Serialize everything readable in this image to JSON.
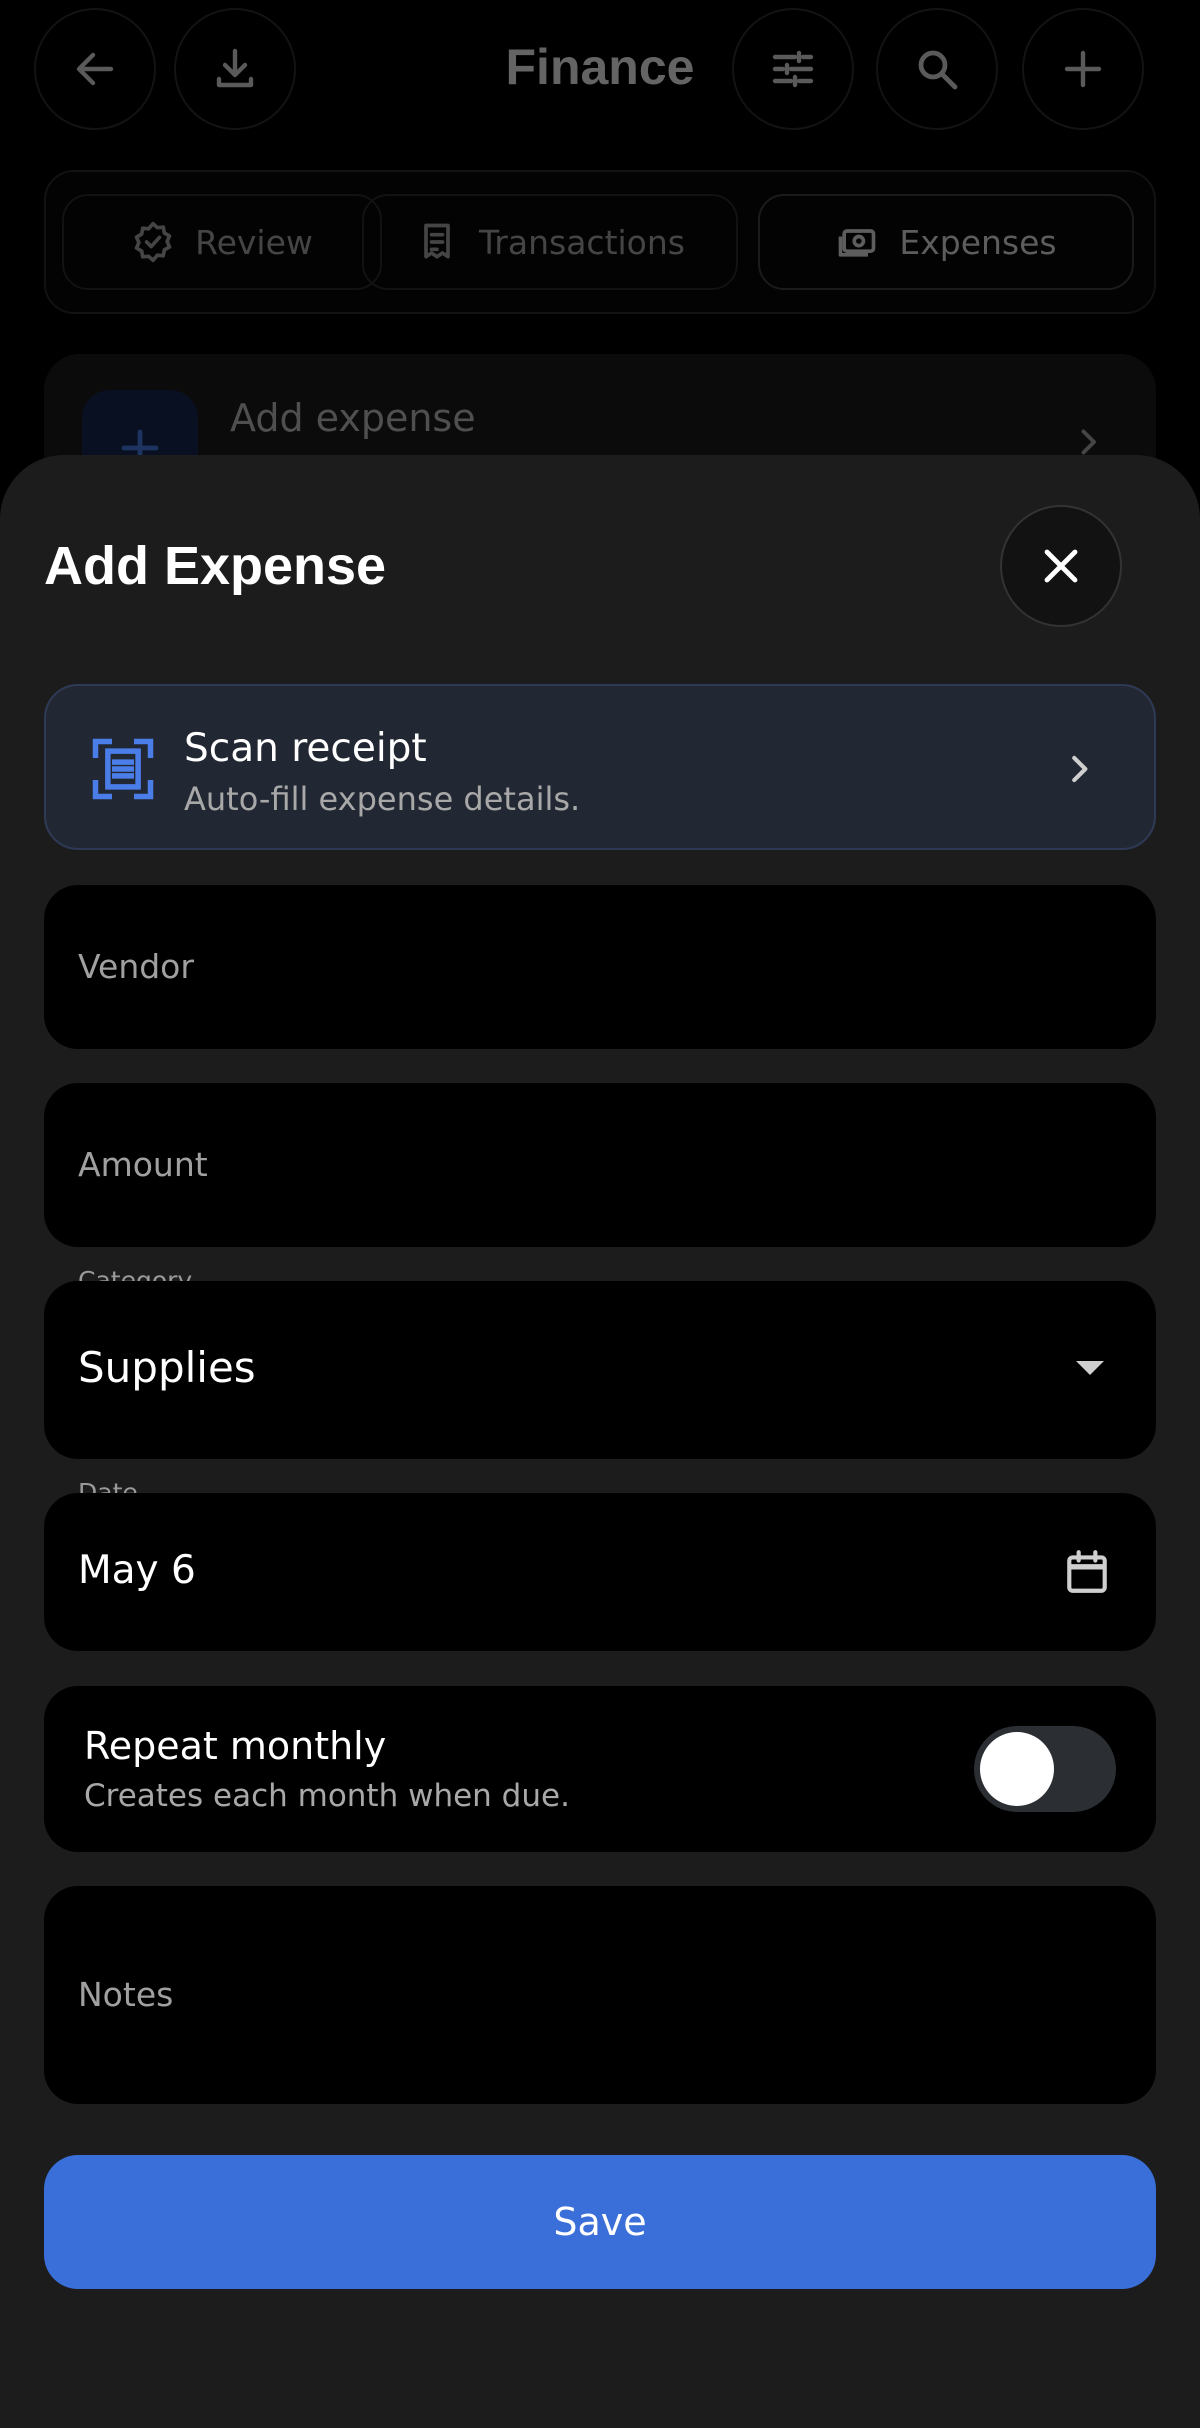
{
  "header": {
    "title": "Finance",
    "icons": [
      "back-arrow-icon",
      "download-icon",
      "filter-sliders-icon",
      "search-icon",
      "plus-icon"
    ]
  },
  "tabs": [
    {
      "label": "Review",
      "icon": "check-badge-icon"
    },
    {
      "label": "Transactions",
      "icon": "receipt-icon"
    },
    {
      "label": "Expenses",
      "icon": "cash-icon",
      "selected": true
    }
  ],
  "list": {
    "add_expense_label": "Add expense"
  },
  "sheet": {
    "title": "Add Expense",
    "scan": {
      "title": "Scan receipt",
      "subtitle": "Auto-fill expense details."
    },
    "vendor": {
      "placeholder": "Vendor",
      "value": ""
    },
    "amount": {
      "placeholder": "Amount",
      "value": ""
    },
    "category": {
      "label": "Category",
      "value": "Supplies"
    },
    "date": {
      "label": "Date",
      "value": "May 6"
    },
    "repeat": {
      "title": "Repeat monthly",
      "subtitle": "Creates each month when due.",
      "enabled": false
    },
    "notes": {
      "placeholder": "Notes",
      "value": ""
    },
    "save_label": "Save"
  },
  "colors": {
    "accent": "#3a6ed8",
    "sheet_bg": "#1c1c1d",
    "field_bg": "#000000",
    "scan_card_bg": "#222833"
  }
}
